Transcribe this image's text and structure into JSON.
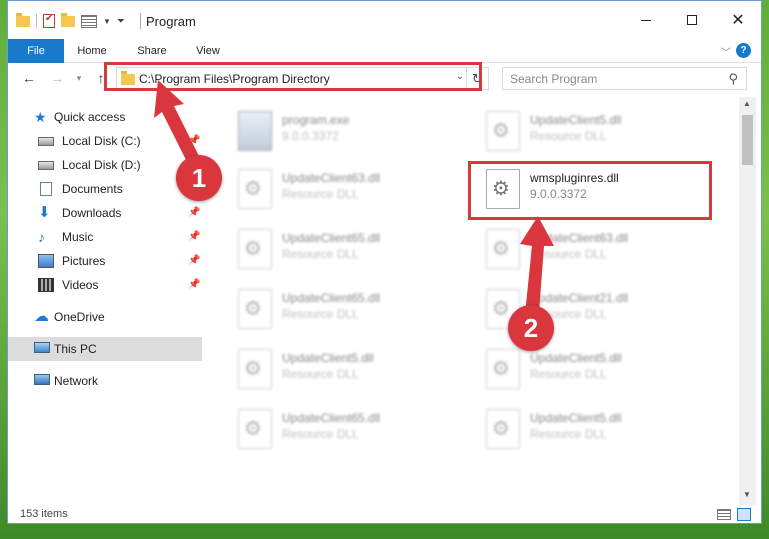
{
  "window": {
    "title": "Program",
    "tabs": {
      "file": "File",
      "home": "Home",
      "share": "Share",
      "view": "View"
    },
    "help": "?"
  },
  "nav": {
    "address": "C:\\Program Files\\Program Directory",
    "search_placeholder": "Search Program"
  },
  "sidebar": {
    "items": [
      {
        "label": "Quick access",
        "icon": "star-icon"
      },
      {
        "label": "Local Disk (C:)",
        "icon": "disk-icon"
      },
      {
        "label": "Local Disk (D:)",
        "icon": "disk-icon"
      },
      {
        "label": "Documents",
        "icon": "documents-icon"
      },
      {
        "label": "Downloads",
        "icon": "downloads-icon"
      },
      {
        "label": "Music",
        "icon": "music-icon"
      },
      {
        "label": "Pictures",
        "icon": "pictures-icon"
      },
      {
        "label": "Videos",
        "icon": "videos-icon"
      },
      {
        "label": "OneDrive",
        "icon": "onedrive-icon"
      },
      {
        "label": "This PC",
        "icon": "this-pc-icon"
      },
      {
        "label": "Network",
        "icon": "network-icon"
      }
    ]
  },
  "files": [
    {
      "name": "program.exe",
      "sub": "9.0.0.3372"
    },
    {
      "name": "UpdateClient5.dll",
      "sub": "Resource DLL"
    },
    {
      "name": "UpdateClient63.dll",
      "sub": "Resource DLL"
    },
    {
      "name": "wmspluginres.dll",
      "sub": "9.0.0.3372"
    },
    {
      "name": "UpdateClient65.dll",
      "sub": "Resource DLL"
    },
    {
      "name": "UpdateClient63.dll",
      "sub": "Resource DLL"
    },
    {
      "name": "UpdateClient65.dll",
      "sub": "Resource DLL"
    },
    {
      "name": "UpdateClient21.dll",
      "sub": "Resource DLL"
    },
    {
      "name": "UpdateClient5.dll",
      "sub": "Resource DLL"
    },
    {
      "name": "UpdateClient5.dll",
      "sub": "Resource DLL"
    },
    {
      "name": "UpdateClient65.dll",
      "sub": "Resource DLL"
    },
    {
      "name": "UpdateClient5.dll",
      "sub": "Resource DLL"
    }
  ],
  "status": {
    "count": "153 items"
  },
  "annotations": {
    "step1": "1",
    "step2": "2"
  },
  "colors": {
    "accent": "#1979ca",
    "highlight": "#d63a3a"
  }
}
